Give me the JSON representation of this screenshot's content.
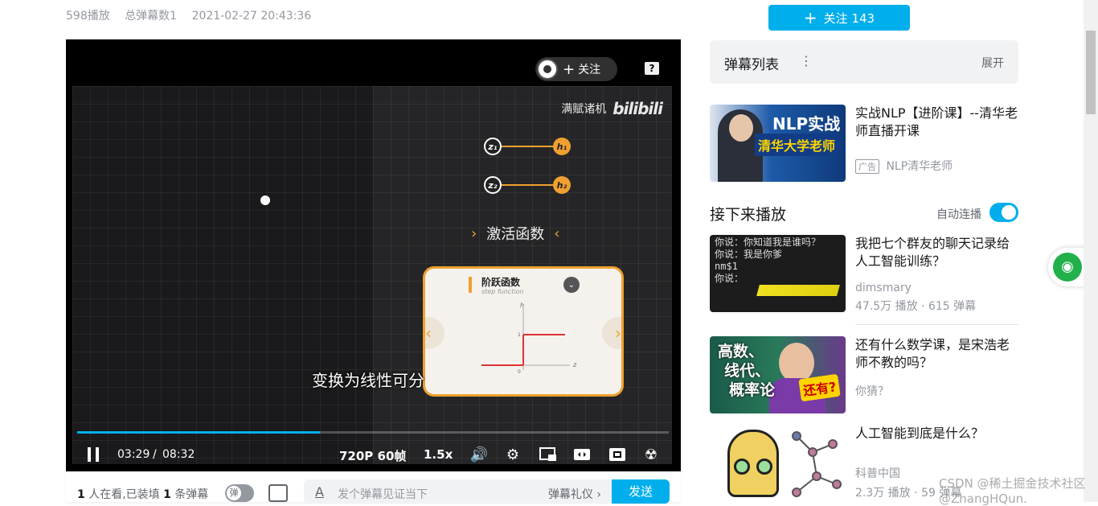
{
  "meta": {
    "plays": "598播放",
    "danmaku_total": "总弹幕数1",
    "datetime": "2021-02-27 20:43:36"
  },
  "player": {
    "follow_pill": "关注",
    "help_icon": "?",
    "video": {
      "brand_text": "满赋诸机",
      "brand_logo": "bilibili",
      "nodes": [
        "z₁",
        "h₁",
        "z₂",
        "h₂"
      ],
      "activation": "激活函数",
      "card_title": "阶跃函数",
      "card_subtitle": "step function",
      "axis_h": "h",
      "axis_z": "z",
      "axis_one": "1",
      "axis_zero": "0",
      "subtitle": "变换为线性可分"
    },
    "progress_fraction": 0.41,
    "current_time": "03:29",
    "time_separator": "/",
    "total_time": "08:32",
    "quality": "720P 60帧",
    "speed": "1.5x"
  },
  "danmaku_bar": {
    "watching_count": "1",
    "watching_text": "人在看,已装填",
    "loaded_count": "1",
    "loaded_text": "条弹幕",
    "toggle_label": "弹",
    "placeholder": "发个弹幕见证当下",
    "etiquette": "弹幕礼仪 ›",
    "send": "发送"
  },
  "sidebar": {
    "follow_label": "关注 143",
    "danmaku_list_title": "弹幕列表",
    "danmaku_list_expand": "展开",
    "ad": {
      "thumb_line1": "NLP实战",
      "thumb_line2": "清华大学老师",
      "title": "实战NLP【进阶课】--清华老师直播开课",
      "tag": "广告",
      "up": "NLP清华老师"
    },
    "next_title": "接下来播放",
    "autoplay_label": "自动连播",
    "videos": [
      {
        "title": "我把七个群友的聊天记录给人工智能训练？",
        "up": "dimsmary",
        "stats": "47.5万 播放 · 615 弹幕",
        "thumb_lines": [
          "你说：你知道我是谁吗？",
          "你说：我是你爹",
          "nm$1",
          "你说："
        ]
      },
      {
        "title": "还有什么数学课，是宋浩老师不教的吗？",
        "up": "你猜？",
        "stats": "",
        "thumb_lines": [
          "高数、",
          "线代、",
          "概率论",
          "还有?"
        ]
      },
      {
        "title": "人工智能到底是什么？",
        "up": "科普中国",
        "stats": "2.3万 播放 · 59 弹幕",
        "thumb_lines": []
      }
    ]
  },
  "watermark": "CSDN @稀土掘金技术社区 @ZhangHQun."
}
